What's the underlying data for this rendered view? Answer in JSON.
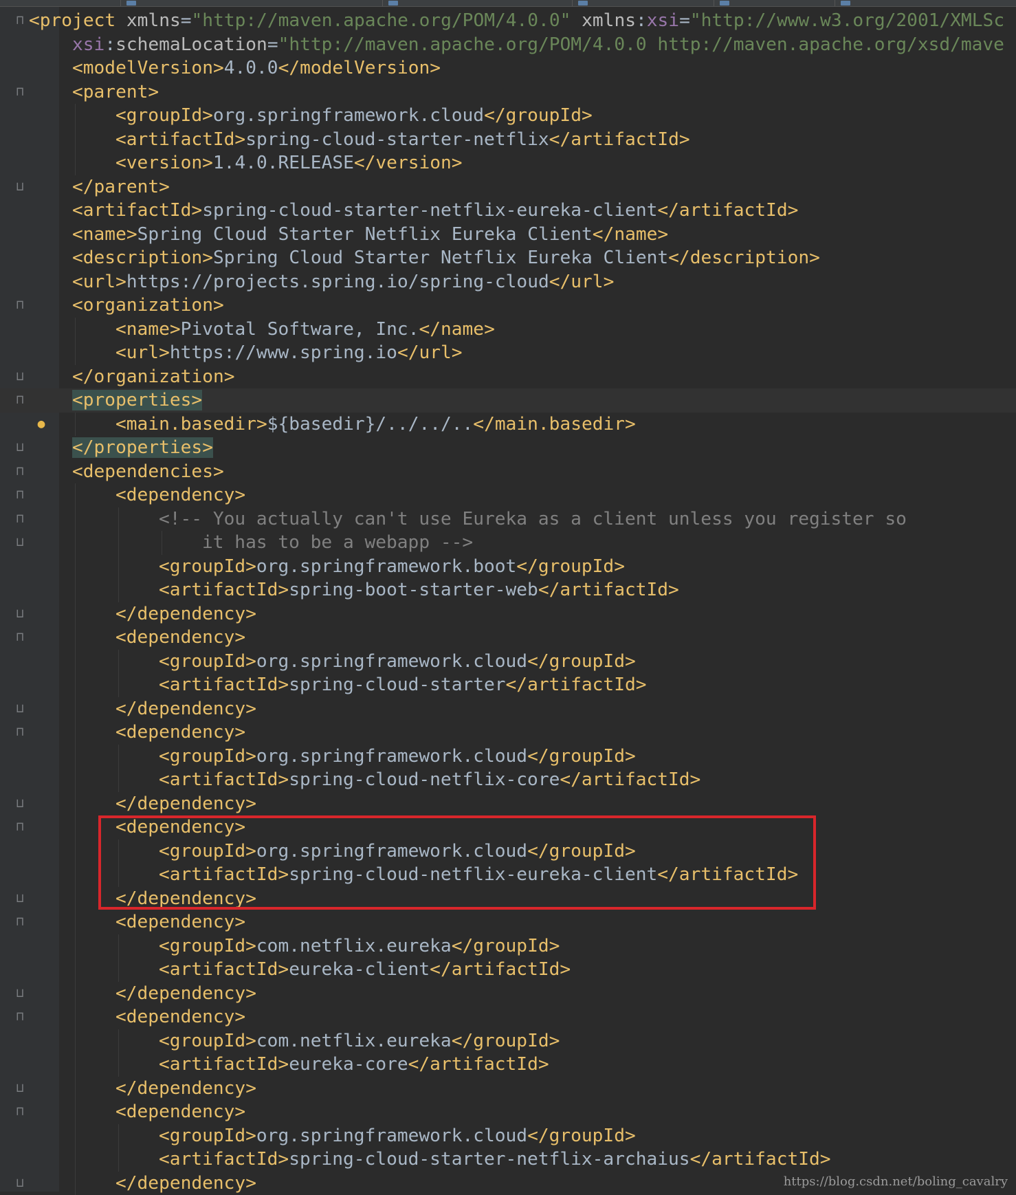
{
  "editor": {
    "file_type": "xml",
    "colors": {
      "background": "#2b2b2b",
      "tag": "#e8bf6a",
      "attribute": "#bababa",
      "namespace": "#9876aa",
      "string": "#6a8759",
      "comment": "#808080",
      "text": "#a9b7c6",
      "highlight_box": "#d8262b"
    },
    "intention_icon": "lightbulb-icon",
    "fold_icon": "fold-marker-icon",
    "lines": [
      {
        "indent": 0,
        "fold": "open",
        "tokens": [
          [
            "t",
            "<project "
          ],
          [
            "a",
            "xmlns"
          ],
          [
            "v",
            "="
          ],
          [
            "s",
            "\"http://maven.apache.org/POM/4.0.0\""
          ],
          [
            "v",
            " "
          ],
          [
            "a",
            "xmlns"
          ],
          [
            "v",
            ":"
          ],
          [
            "ns",
            "xsi"
          ],
          [
            "v",
            "="
          ],
          [
            "s",
            "\"http://www.w3.org/2001/XMLSc"
          ]
        ]
      },
      {
        "indent": 1,
        "fold": "",
        "tokens": [
          [
            "ns",
            "xsi"
          ],
          [
            "v",
            ":"
          ],
          [
            "a",
            "schemaLocation"
          ],
          [
            "v",
            "="
          ],
          [
            "s",
            "\"http://maven.apache.org/POM/4.0.0 http://maven.apache.org/xsd/mave"
          ]
        ]
      },
      {
        "indent": 1,
        "fold": "",
        "tokens": [
          [
            "t",
            "<modelVersion>"
          ],
          [
            "v",
            "4.0.0"
          ],
          [
            "t",
            "</modelVersion>"
          ]
        ]
      },
      {
        "indent": 1,
        "fold": "open",
        "tokens": [
          [
            "t",
            "<parent>"
          ]
        ]
      },
      {
        "indent": 2,
        "fold": "",
        "tokens": [
          [
            "t",
            "<groupId>"
          ],
          [
            "v",
            "org.springframework.cloud"
          ],
          [
            "t",
            "</groupId>"
          ]
        ]
      },
      {
        "indent": 2,
        "fold": "",
        "tokens": [
          [
            "t",
            "<artifactId>"
          ],
          [
            "v",
            "spring-cloud-starter-netflix"
          ],
          [
            "t",
            "</artifactId>"
          ]
        ]
      },
      {
        "indent": 2,
        "fold": "",
        "tokens": [
          [
            "t",
            "<version>"
          ],
          [
            "v",
            "1.4.0.RELEASE"
          ],
          [
            "t",
            "</version>"
          ]
        ]
      },
      {
        "indent": 1,
        "fold": "close",
        "tokens": [
          [
            "t",
            "</parent>"
          ]
        ]
      },
      {
        "indent": 1,
        "fold": "",
        "tokens": [
          [
            "t",
            "<artifactId>"
          ],
          [
            "v",
            "spring-cloud-starter-netflix-eureka-client"
          ],
          [
            "t",
            "</artifactId>"
          ]
        ]
      },
      {
        "indent": 1,
        "fold": "",
        "tokens": [
          [
            "t",
            "<name>"
          ],
          [
            "v",
            "Spring Cloud Starter Netflix Eureka Client"
          ],
          [
            "t",
            "</name>"
          ]
        ]
      },
      {
        "indent": 1,
        "fold": "",
        "tokens": [
          [
            "t",
            "<description>"
          ],
          [
            "v",
            "Spring Cloud Starter Netflix Eureka Client"
          ],
          [
            "t",
            "</description>"
          ]
        ]
      },
      {
        "indent": 1,
        "fold": "",
        "tokens": [
          [
            "t",
            "<url>"
          ],
          [
            "v",
            "https://projects.spring.io/spring-cloud"
          ],
          [
            "t",
            "</url>"
          ]
        ]
      },
      {
        "indent": 1,
        "fold": "open",
        "tokens": [
          [
            "t",
            "<organization>"
          ]
        ]
      },
      {
        "indent": 2,
        "fold": "",
        "tokens": [
          [
            "t",
            "<name>"
          ],
          [
            "v",
            "Pivotal Software, Inc."
          ],
          [
            "t",
            "</name>"
          ]
        ]
      },
      {
        "indent": 2,
        "fold": "",
        "tokens": [
          [
            "t",
            "<url>"
          ],
          [
            "v",
            "https://www.spring.io"
          ],
          [
            "t",
            "</url>"
          ]
        ]
      },
      {
        "indent": 1,
        "fold": "close",
        "tokens": [
          [
            "t",
            "</organization>"
          ]
        ]
      },
      {
        "indent": 1,
        "fold": "open",
        "caret": true,
        "tokens": [
          [
            "t hl",
            "<properties>"
          ]
        ]
      },
      {
        "indent": 2,
        "fold": "",
        "bulb": true,
        "tokens": [
          [
            "t",
            "<main.basedir>"
          ],
          [
            "v",
            "${basedir}/../../.."
          ],
          [
            "t",
            "</main.basedir>"
          ]
        ]
      },
      {
        "indent": 1,
        "fold": "close",
        "tokens": [
          [
            "t hl",
            "</properties>"
          ]
        ]
      },
      {
        "indent": 1,
        "fold": "open",
        "tokens": [
          [
            "t",
            "<dependencies>"
          ]
        ]
      },
      {
        "indent": 2,
        "fold": "open",
        "tokens": [
          [
            "t",
            "<dependency>"
          ]
        ]
      },
      {
        "indent": 3,
        "fold": "open",
        "tokens": [
          [
            "c",
            "<!-- You actually can't use Eureka as a client unless you register so"
          ]
        ]
      },
      {
        "indent": 4,
        "fold": "close",
        "tokens": [
          [
            "c",
            "it has to be a webapp -->"
          ]
        ]
      },
      {
        "indent": 3,
        "fold": "",
        "tokens": [
          [
            "t",
            "<groupId>"
          ],
          [
            "v",
            "org.springframework.boot"
          ],
          [
            "t",
            "</groupId>"
          ]
        ]
      },
      {
        "indent": 3,
        "fold": "",
        "tokens": [
          [
            "t",
            "<artifactId>"
          ],
          [
            "v",
            "spring-boot-starter-web"
          ],
          [
            "t",
            "</artifactId>"
          ]
        ]
      },
      {
        "indent": 2,
        "fold": "close",
        "tokens": [
          [
            "t",
            "</dependency>"
          ]
        ]
      },
      {
        "indent": 2,
        "fold": "open",
        "tokens": [
          [
            "t",
            "<dependency>"
          ]
        ]
      },
      {
        "indent": 3,
        "fold": "",
        "tokens": [
          [
            "t",
            "<groupId>"
          ],
          [
            "v",
            "org.springframework.cloud"
          ],
          [
            "t",
            "</groupId>"
          ]
        ]
      },
      {
        "indent": 3,
        "fold": "",
        "tokens": [
          [
            "t",
            "<artifactId>"
          ],
          [
            "v",
            "spring-cloud-starter"
          ],
          [
            "t",
            "</artifactId>"
          ]
        ]
      },
      {
        "indent": 2,
        "fold": "close",
        "tokens": [
          [
            "t",
            "</dependency>"
          ]
        ]
      },
      {
        "indent": 2,
        "fold": "open",
        "tokens": [
          [
            "t",
            "<dependency>"
          ]
        ]
      },
      {
        "indent": 3,
        "fold": "",
        "tokens": [
          [
            "t",
            "<groupId>"
          ],
          [
            "v",
            "org.springframework.cloud"
          ],
          [
            "t",
            "</groupId>"
          ]
        ]
      },
      {
        "indent": 3,
        "fold": "",
        "tokens": [
          [
            "t",
            "<artifactId>"
          ],
          [
            "v",
            "spring-cloud-netflix-core"
          ],
          [
            "t",
            "</artifactId>"
          ]
        ]
      },
      {
        "indent": 2,
        "fold": "close",
        "tokens": [
          [
            "t",
            "</dependency>"
          ]
        ]
      },
      {
        "indent": 2,
        "fold": "open",
        "tokens": [
          [
            "t",
            "<dependency>"
          ]
        ]
      },
      {
        "indent": 3,
        "fold": "",
        "tokens": [
          [
            "t",
            "<groupId>"
          ],
          [
            "v",
            "org.springframework.cloud"
          ],
          [
            "t",
            "</groupId>"
          ]
        ]
      },
      {
        "indent": 3,
        "fold": "",
        "tokens": [
          [
            "t",
            "<artifactId>"
          ],
          [
            "v",
            "spring-cloud-netflix-eureka-client"
          ],
          [
            "t",
            "</artifactId>"
          ]
        ]
      },
      {
        "indent": 2,
        "fold": "close",
        "tokens": [
          [
            "t",
            "</dependency>"
          ]
        ]
      },
      {
        "indent": 2,
        "fold": "open",
        "tokens": [
          [
            "t",
            "<dependency>"
          ]
        ]
      },
      {
        "indent": 3,
        "fold": "",
        "tokens": [
          [
            "t",
            "<groupId>"
          ],
          [
            "v",
            "com.netflix.eureka"
          ],
          [
            "t",
            "</groupId>"
          ]
        ]
      },
      {
        "indent": 3,
        "fold": "",
        "tokens": [
          [
            "t",
            "<artifactId>"
          ],
          [
            "v",
            "eureka-client"
          ],
          [
            "t",
            "</artifactId>"
          ]
        ]
      },
      {
        "indent": 2,
        "fold": "close",
        "tokens": [
          [
            "t",
            "</dependency>"
          ]
        ]
      },
      {
        "indent": 2,
        "fold": "open",
        "tokens": [
          [
            "t",
            "<dependency>"
          ]
        ]
      },
      {
        "indent": 3,
        "fold": "",
        "tokens": [
          [
            "t",
            "<groupId>"
          ],
          [
            "v",
            "com.netflix.eureka"
          ],
          [
            "t",
            "</groupId>"
          ]
        ]
      },
      {
        "indent": 3,
        "fold": "",
        "tokens": [
          [
            "t",
            "<artifactId>"
          ],
          [
            "v",
            "eureka-core"
          ],
          [
            "t",
            "</artifactId>"
          ]
        ]
      },
      {
        "indent": 2,
        "fold": "close",
        "tokens": [
          [
            "t",
            "</dependency>"
          ]
        ]
      },
      {
        "indent": 2,
        "fold": "open",
        "tokens": [
          [
            "t",
            "<dependency>"
          ]
        ]
      },
      {
        "indent": 3,
        "fold": "",
        "tokens": [
          [
            "t",
            "<groupId>"
          ],
          [
            "v",
            "org.springframework.cloud"
          ],
          [
            "t",
            "</groupId>"
          ]
        ]
      },
      {
        "indent": 3,
        "fold": "",
        "tokens": [
          [
            "t",
            "<artifactId>"
          ],
          [
            "v",
            "spring-cloud-starter-netflix-archaius"
          ],
          [
            "t",
            "</artifactId>"
          ]
        ]
      },
      {
        "indent": 2,
        "fold": "close",
        "tokens": [
          [
            "t",
            "</dependency>"
          ]
        ]
      }
    ]
  },
  "watermark": "https://blog.csdn.net/boling_cavalry"
}
